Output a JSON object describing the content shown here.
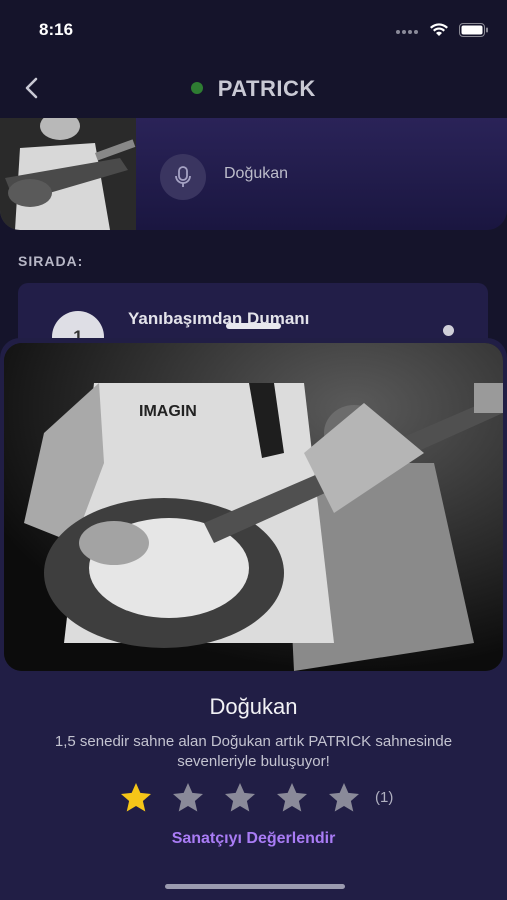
{
  "status_bar": {
    "time": "8:16"
  },
  "nav": {
    "title": "PATRICK",
    "status_color": "#2e7d32"
  },
  "now_playing": {
    "performer": "Doğukan"
  },
  "queue": {
    "label": "SIRADA:",
    "items": [
      {
        "number": "1",
        "title": "Yanıbaşımdan Dumanı"
      }
    ]
  },
  "artist_sheet": {
    "name": "Doğukan",
    "description": "1,5 senedir sahne alan Doğukan artık PATRICK sahnesinde sevenleriyle buluşuyor!",
    "rating": {
      "filled_stars": 1,
      "max_stars": 5,
      "count_text": "(1)"
    },
    "rate_label": "Sanatçıyı Değerlendir",
    "photo_shirt_text": "IMAGIN"
  },
  "colors": {
    "background": "#15142b",
    "sheet": "#211e45",
    "accent": "#a97cf5",
    "star_filled": "#f5c518",
    "star_empty": "#8a8a99"
  },
  "icons": [
    "signal-icon",
    "wifi-icon",
    "battery-icon",
    "back-chevron-icon",
    "microphone-icon",
    "star-icon"
  ]
}
